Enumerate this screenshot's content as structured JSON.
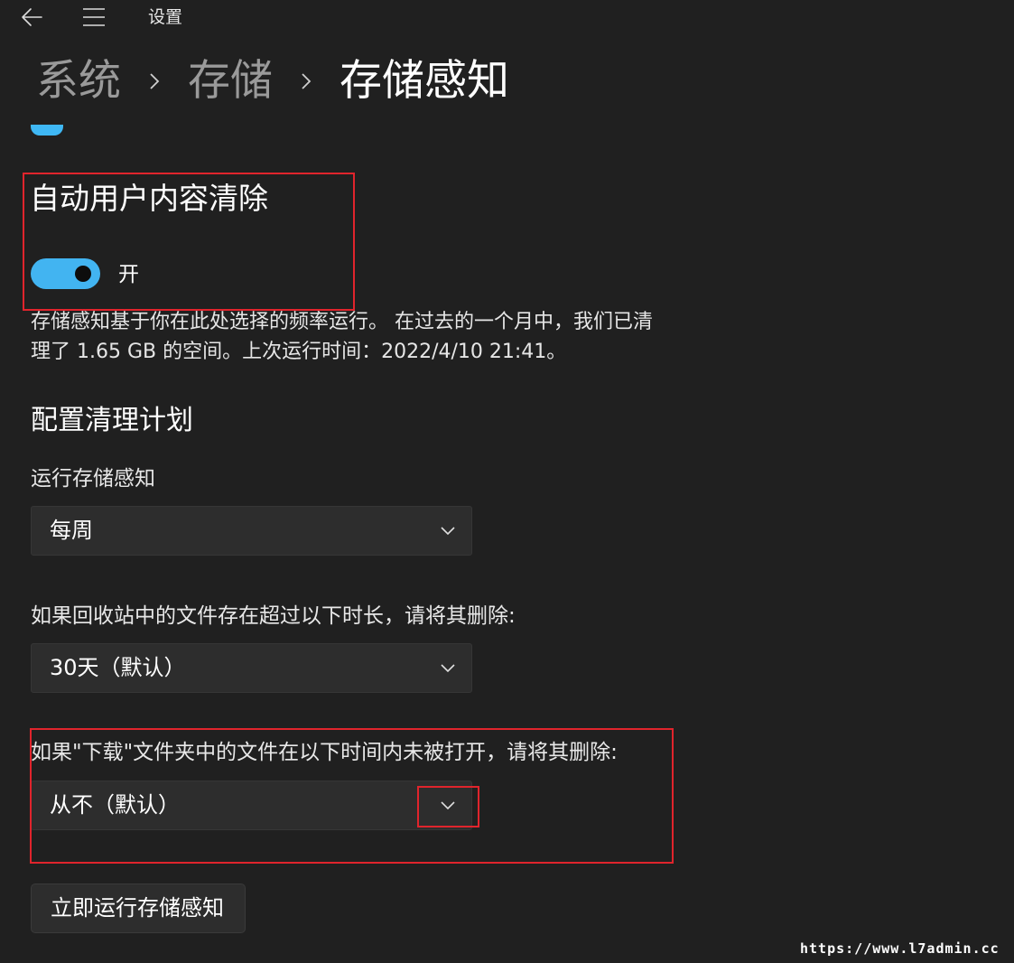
{
  "titlebar": {
    "title": "设置",
    "back_icon": "back-arrow-icon",
    "menu_icon": "hamburger-menu-icon"
  },
  "breadcrumb": {
    "items": [
      "系统",
      "存储",
      "存储感知"
    ],
    "separator_icon": "chevron-right-icon"
  },
  "auto_cleanup": {
    "title": "自动用户内容清除",
    "toggle_state": "开",
    "toggle_on": true,
    "description_line1": "存储感知基于你在此处选择的频率运行。 在过去的一个月中，我们已清",
    "description_line2": "理了 1.65 GB 的空间。上次运行时间：2022/4/10 21:41。"
  },
  "schedule": {
    "title": "配置清理计划",
    "run_label": "运行存储感知",
    "run_value": "每周",
    "recycle_label": "如果回收站中的文件存在超过以下时长，请将其删除:",
    "recycle_value": "30天（默认）",
    "downloads_label": "如果\"下载\"文件夹中的文件在以下时间内未被打开，请将其删除:",
    "downloads_value": "从不（默认）"
  },
  "actions": {
    "run_now_label": "立即运行存储感知"
  },
  "watermark": "https://www.l7admin.cc",
  "colors": {
    "background": "#202020",
    "accent": "#42b4f1",
    "control": "#2d2d2d",
    "highlight": "#e0242c"
  }
}
